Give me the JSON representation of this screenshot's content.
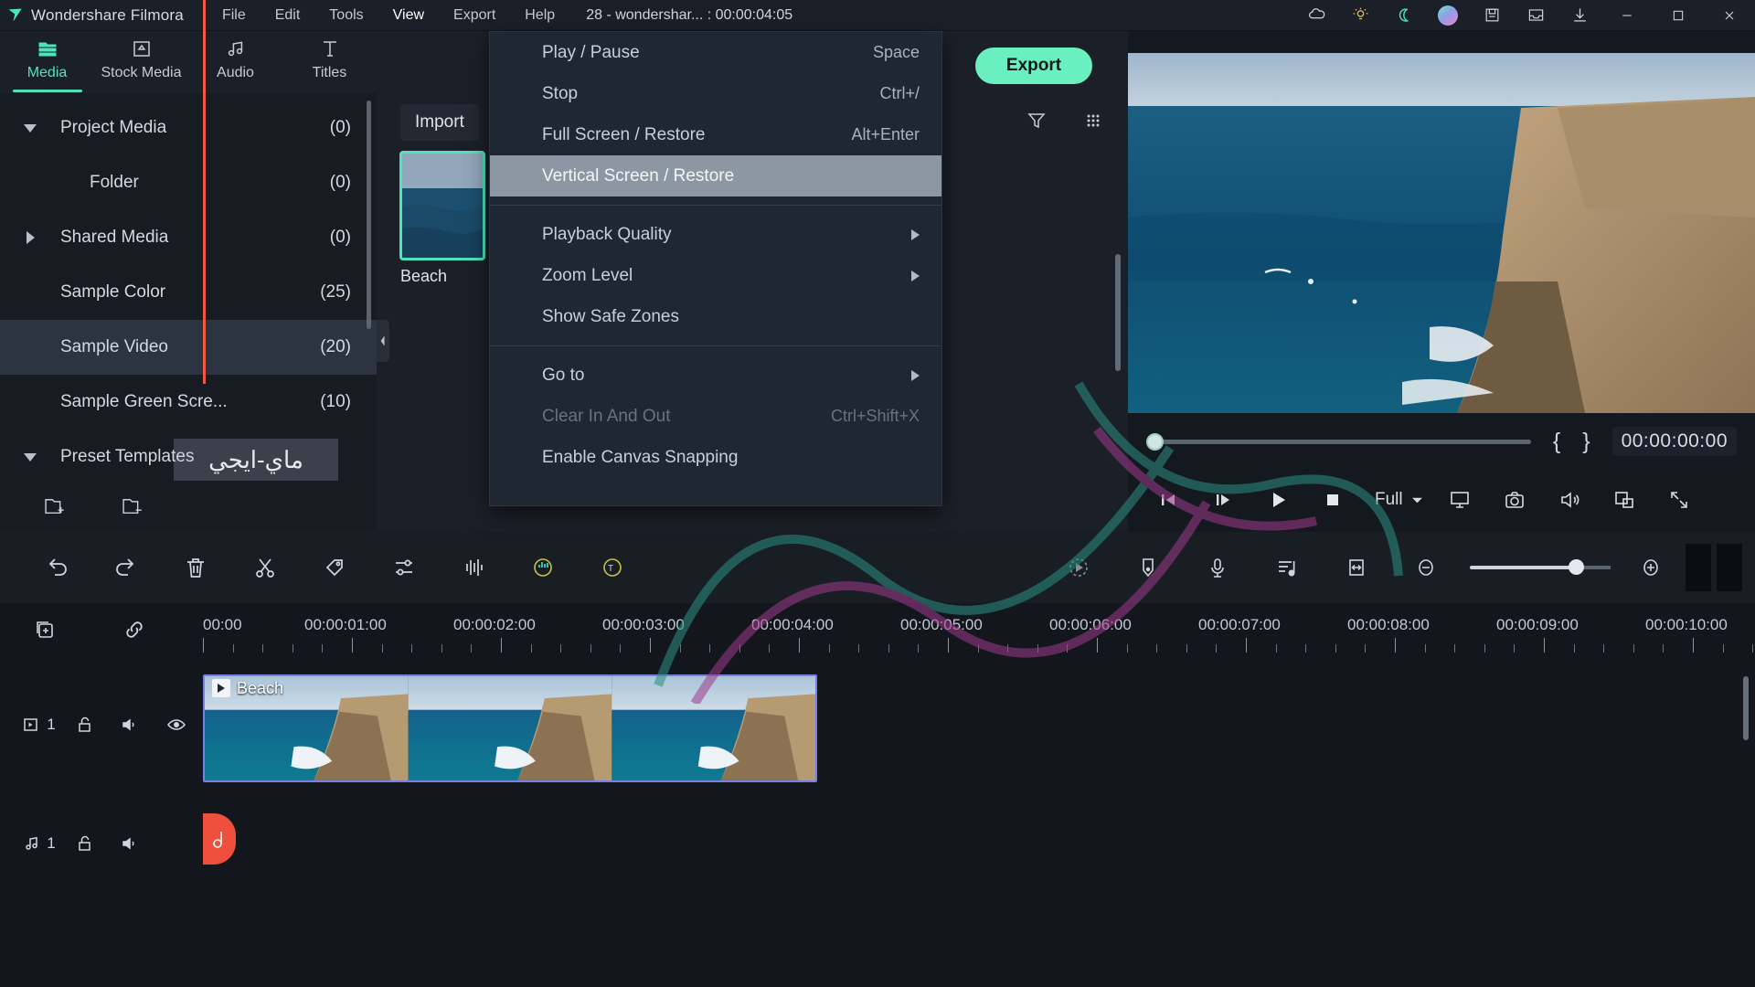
{
  "titlebar": {
    "app_name": "Wondershare Filmora",
    "menus": [
      {
        "label": "File",
        "active": false
      },
      {
        "label": "Edit",
        "active": false
      },
      {
        "label": "Tools",
        "active": false
      },
      {
        "label": "View",
        "active": true
      },
      {
        "label": "Export",
        "active": false
      },
      {
        "label": "Help",
        "active": false
      }
    ],
    "project_info": "28 - wondershar... : 00:00:04:05",
    "right_icons": [
      "cloud-icon",
      "lightbulb-icon",
      "moon-icon",
      "avatar",
      "save-icon",
      "inbox-icon",
      "download-icon"
    ],
    "window_buttons": [
      "minimize-icon",
      "maximize-icon",
      "close-icon"
    ]
  },
  "left_tabs": [
    {
      "label": "Media",
      "icon": "folder-icon",
      "active": true
    },
    {
      "label": "Stock Media",
      "icon": "stock-media-icon",
      "active": false
    },
    {
      "label": "Audio",
      "icon": "music-note-icon",
      "active": false
    },
    {
      "label": "Titles",
      "icon": "text-t-icon",
      "active": false
    }
  ],
  "toolbar": {
    "export_label": "Export"
  },
  "sidebar": {
    "items": [
      {
        "label": "Project Media",
        "count": "(0)",
        "caret": "down",
        "indent": false,
        "selected": false
      },
      {
        "label": "Folder",
        "count": "(0)",
        "caret": "none",
        "indent": true,
        "selected": false
      },
      {
        "label": "Shared Media",
        "count": "(0)",
        "caret": "right",
        "indent": false,
        "selected": false
      },
      {
        "label": "Sample Color",
        "count": "(25)",
        "caret": "none",
        "indent": false,
        "selected": false
      },
      {
        "label": "Sample Video",
        "count": "(20)",
        "caret": "none",
        "indent": false,
        "selected": true
      },
      {
        "label": "Sample Green Scre...",
        "count": "(10)",
        "caret": "none",
        "indent": false,
        "selected": false
      },
      {
        "label": "Preset Templates",
        "count": "",
        "caret": "down",
        "indent": false,
        "selected": false
      }
    ],
    "bottom_icons": [
      "new-folder-icon",
      "remove-folder-icon"
    ]
  },
  "media_panel": {
    "import_label": "Import",
    "tool_icons": [
      "filter-icon",
      "grid-view-icon"
    ],
    "items": [
      {
        "caption": "Beach",
        "selected": true,
        "kind": "sea"
      },
      {
        "caption": "",
        "selected": false,
        "kind": "fire"
      }
    ]
  },
  "preview": {
    "timecode": "00:00:00:00",
    "mark_in": "{",
    "mark_out": "}",
    "quality_label": "Full",
    "controls": [
      "prev-frame-icon",
      "next-frame-icon",
      "play-icon",
      "stop-icon"
    ],
    "right_controls": [
      "display-icon",
      "snapshot-icon",
      "volume-icon",
      "pip-icon",
      "fullscreen-icon"
    ]
  },
  "menu": {
    "items": [
      {
        "label": "Play / Pause",
        "shortcut": "Space",
        "kind": "item"
      },
      {
        "label": "Stop",
        "shortcut": "Ctrl+/",
        "kind": "item"
      },
      {
        "label": "Full Screen / Restore",
        "shortcut": "Alt+Enter",
        "kind": "item"
      },
      {
        "label": "Vertical Screen / Restore",
        "shortcut": "",
        "kind": "item",
        "highlighted": true
      },
      {
        "kind": "separator"
      },
      {
        "label": "Playback Quality",
        "shortcut": "",
        "kind": "submenu"
      },
      {
        "label": "Zoom Level",
        "shortcut": "",
        "kind": "submenu"
      },
      {
        "label": "Show Safe Zones",
        "shortcut": "",
        "kind": "item"
      },
      {
        "kind": "separator"
      },
      {
        "label": "Go to",
        "shortcut": "",
        "kind": "submenu"
      },
      {
        "label": "Clear In And Out",
        "shortcut": "Ctrl+Shift+X",
        "kind": "item",
        "disabled": true
      },
      {
        "label": "Enable Canvas Snapping",
        "shortcut": "",
        "kind": "item"
      }
    ]
  },
  "timeline_toolbar": {
    "left_icons": [
      "undo-icon",
      "redo-icon",
      "delete-icon",
      "split-scissors-icon",
      "marker-tag-icon",
      "adjust-sliders-icon",
      "audio-waveform-icon",
      "auto-beat-sync-icon",
      "auto-text-icon"
    ],
    "right_icons": [
      "render-preview-icon",
      "marker-icon",
      "record-voiceover-icon",
      "audio-mixer-icon",
      "fit-timeline-icon",
      "zoom-out-icon",
      "zoom-slider",
      "zoom-in-icon"
    ]
  },
  "timeline": {
    "head_icons": [
      "add-track-icon",
      "link-icon"
    ],
    "ruler_ticks": [
      "00:00",
      "00:00:01:00",
      "00:00:02:00",
      "00:00:03:00",
      "00:00:04:00",
      "00:00:05:00",
      "00:00:06:00",
      "00:00:07:00",
      "00:00:08:00",
      "00:00:09:00",
      "00:00:10:00"
    ],
    "tracks": [
      {
        "type": "video",
        "number": "1",
        "icons": [
          "video-track-icon",
          "lock-open-icon",
          "mute-icon",
          "eye-icon"
        ],
        "clip": {
          "label": "Beach"
        }
      },
      {
        "type": "audio",
        "number": "1",
        "icons": [
          "audio-track-icon",
          "lock-open-icon",
          "mute-icon"
        ],
        "clip": null
      }
    ]
  },
  "watermark": {
    "arabic": "ماي-ايجي"
  },
  "colors": {
    "accent": "#4fe3bd",
    "export_button": "#69efc0",
    "playhead": "#f2583f",
    "menu_bg": "#1f2733",
    "menu_highlight": "#8d97a3",
    "panel_bg": "#1b2028",
    "sidebar_bg": "#171c23",
    "timeline_bg": "#13171d"
  }
}
